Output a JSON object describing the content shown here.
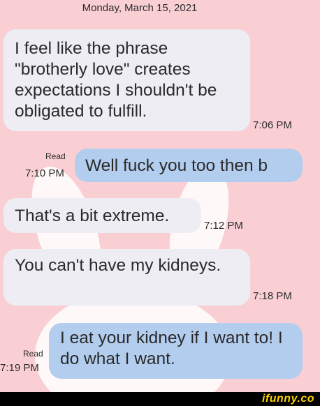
{
  "conversation": {
    "date": "Monday, March 15, 2021",
    "messages": [
      {
        "direction": "received",
        "text": "I feel like the phrase \"brotherly love\" creates expectations I shouldn't be obligated to fulfill.",
        "time": "7:06 PM"
      },
      {
        "direction": "sent",
        "text": "Well fuck you too then b",
        "time": "7:10 PM",
        "status": "Read"
      },
      {
        "direction": "received",
        "text": "That's a bit extreme.",
        "time": "7:12 PM"
      },
      {
        "direction": "received",
        "text": "You can't have my kidneys.",
        "time": "7:18 PM"
      },
      {
        "direction": "sent",
        "text": "I eat your kidney if I want to! I do what I want.",
        "time": "7:19 PM",
        "status": "Read"
      }
    ]
  },
  "watermark": {
    "logo_text": "ifunny.co"
  },
  "colors": {
    "background": "#f9cfd4",
    "received_bubble": "#ededf3",
    "sent_bubble": "#b3cdef",
    "logo": "#fbd000"
  }
}
